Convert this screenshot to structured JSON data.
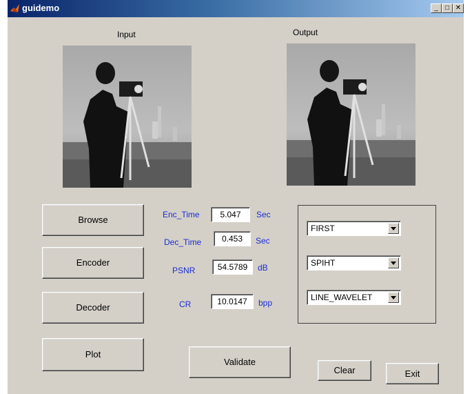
{
  "window": {
    "title": "guidemo"
  },
  "titlebar": {
    "minimize": "_",
    "maximize": "□",
    "close": "✕"
  },
  "images": {
    "input_label": "Input",
    "output_label": "Output"
  },
  "buttons": {
    "browse": "Browse",
    "encoder": "Encoder",
    "decoder": "Decoder",
    "plot": "Plot",
    "validate": "Validate",
    "clear": "Clear",
    "exit": "Exit"
  },
  "metrics": [
    {
      "label": "Enc_Time",
      "value": "5.047",
      "unit": "Sec"
    },
    {
      "label": "Dec_Time",
      "value": "0.453",
      "unit": "Sec"
    },
    {
      "label": "PSNR",
      "value": "54.5789",
      "unit": "dB"
    },
    {
      "label": "CR",
      "value": "10.0147",
      "unit": "bpp"
    }
  ],
  "selects": [
    {
      "value": "FIRST"
    },
    {
      "value": "SPIHT"
    },
    {
      "value": "LINE_WAVELET"
    }
  ],
  "colors": {
    "label_blue": "#1a2bd6",
    "window_bg": "#d4d0c8"
  }
}
